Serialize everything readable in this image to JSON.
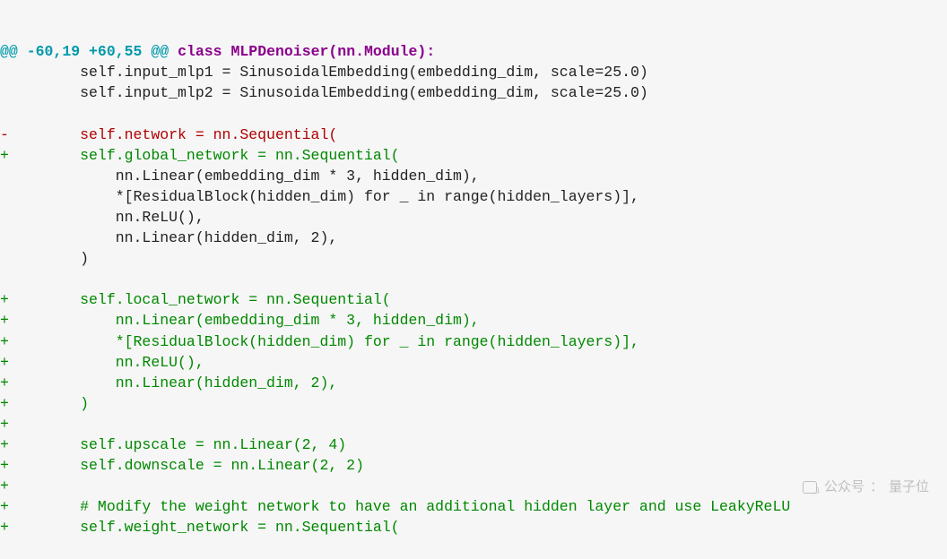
{
  "hunk": {
    "at_prefix": "@@ ",
    "range": "-60,19 +60,55",
    "at_suffix": " @@",
    "context": " class MLPDenoiser(nn.Module):"
  },
  "lines": [
    {
      "type": "context",
      "text": "         self.input_mlp1 = SinusoidalEmbedding(embedding_dim, scale=25.0)"
    },
    {
      "type": "context",
      "text": "         self.input_mlp2 = SinusoidalEmbedding(embedding_dim, scale=25.0)"
    },
    {
      "type": "context",
      "text": " "
    },
    {
      "type": "removed",
      "text": "-        self.network = nn.Sequential("
    },
    {
      "type": "added",
      "text": "+        self.global_network = nn.Sequential("
    },
    {
      "type": "context",
      "text": "             nn.Linear(embedding_dim * 3, hidden_dim),"
    },
    {
      "type": "context",
      "text": "             *[ResidualBlock(hidden_dim) for _ in range(hidden_layers)],"
    },
    {
      "type": "context",
      "text": "             nn.ReLU(),"
    },
    {
      "type": "context",
      "text": "             nn.Linear(hidden_dim, 2),"
    },
    {
      "type": "context",
      "text": "         )"
    },
    {
      "type": "context",
      "text": " "
    },
    {
      "type": "added",
      "text": "+        self.local_network = nn.Sequential("
    },
    {
      "type": "added",
      "text": "+            nn.Linear(embedding_dim * 3, hidden_dim),"
    },
    {
      "type": "added",
      "text": "+            *[ResidualBlock(hidden_dim) for _ in range(hidden_layers)],"
    },
    {
      "type": "added",
      "text": "+            nn.ReLU(),"
    },
    {
      "type": "added",
      "text": "+            nn.Linear(hidden_dim, 2),"
    },
    {
      "type": "added",
      "text": "+        )"
    },
    {
      "type": "added",
      "text": "+"
    },
    {
      "type": "added",
      "text": "+        self.upscale = nn.Linear(2, 4)"
    },
    {
      "type": "added",
      "text": "+        self.downscale = nn.Linear(2, 2)"
    },
    {
      "type": "added",
      "text": "+"
    },
    {
      "type": "added",
      "text": "+        # Modify the weight network to have an additional hidden layer and use LeakyReLU"
    },
    {
      "type": "added",
      "text": "+        self.weight_network = nn.Sequential("
    }
  ],
  "watermark": {
    "label": "公众号",
    "sep": "：",
    "name": "量子位"
  }
}
